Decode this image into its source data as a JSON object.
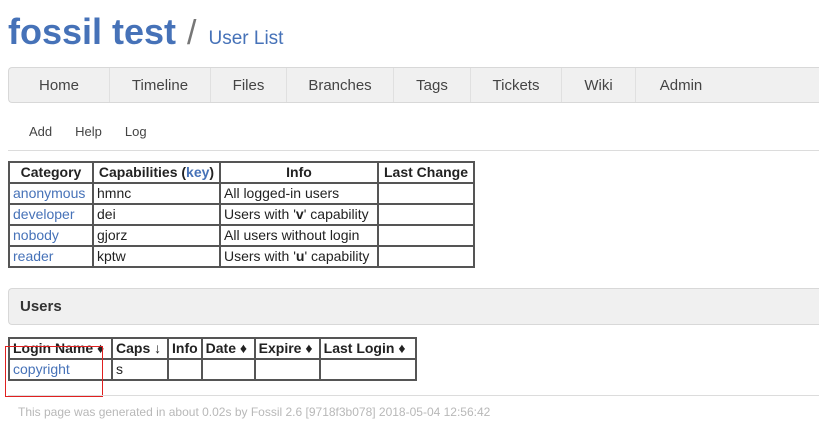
{
  "header": {
    "project_name": "fossil test",
    "separator": "/",
    "page_name": "User List"
  },
  "mainmenu": [
    "Home",
    "Timeline",
    "Files",
    "Branches",
    "Tags",
    "Tickets",
    "Wiki",
    "Admin"
  ],
  "submenu": [
    "Add",
    "Help",
    "Log"
  ],
  "categories_table": {
    "headers": {
      "category": "Category",
      "capabilities_prefix": "Capabilities (",
      "capabilities_link": "key",
      "capabilities_suffix": ")",
      "info": "Info",
      "last_change": "Last Change"
    },
    "rows": [
      {
        "category": "anonymous",
        "caps": "hmnc",
        "info_pre": "All logged-in users",
        "info_cap": "",
        "info_post": "",
        "last_change": ""
      },
      {
        "category": "developer",
        "caps": "dei",
        "info_pre": "Users with '",
        "info_cap": "v",
        "info_post": "' capability",
        "last_change": ""
      },
      {
        "category": "nobody",
        "caps": "gjorz",
        "info_pre": "All users without login",
        "info_cap": "",
        "info_post": "",
        "last_change": ""
      },
      {
        "category": "reader",
        "caps": "kptw",
        "info_pre": "Users with '",
        "info_cap": "u",
        "info_post": "' capability",
        "last_change": ""
      }
    ]
  },
  "users_section": {
    "title": "Users"
  },
  "users_table": {
    "headers": [
      "Login Name ♦",
      "Caps ↓",
      "Info",
      "Date ♦",
      "Expire ♦",
      "Last Login ♦"
    ],
    "rows": [
      {
        "login": "copyright",
        "caps": "s",
        "info": "",
        "date": "",
        "expire": "",
        "last_login": ""
      }
    ]
  },
  "footer": {
    "text": "This page was generated in about 0.02s by Fossil 2.6 [9718f3b078] 2018-05-04 12:56:42"
  },
  "colors": {
    "link": "#4672b8",
    "highlight": "#e02020",
    "menu_bg": "#f0f0f0"
  }
}
